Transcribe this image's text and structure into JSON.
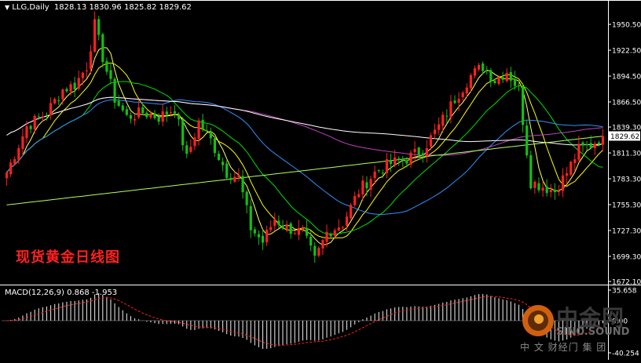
{
  "header": {
    "symbol": "LLG,Daily",
    "ohlc": "1828.13 1830.96 1825.82 1829.62"
  },
  "macd": {
    "label": "MACD(12,26,9) 0.868 -1.953",
    "ticks": [
      "35.658",
      "0.00",
      "-40.254"
    ]
  },
  "overlay_title": "现货黄金日线图",
  "watermark": {
    "cn": "中金网",
    "en": "SINO.SOUND",
    "sub": "中 文 财经门 集 团"
  },
  "price_axis": {
    "ticks": [
      "1950.50",
      "1922.50",
      "1894.50",
      "1866.50",
      "1839.30",
      "1811.30",
      "1783.30",
      "1755.30",
      "1727.30",
      "1699.30",
      "1672.10"
    ],
    "current": "1829.62"
  },
  "colors": {
    "up": "#ff2020",
    "down": "#10c010",
    "ma_fast": "#ffff60",
    "ma_mid": "#ffff00",
    "ma_green": "#00e000",
    "ma_blue": "#3090ff",
    "ma_magenta": "#c040c0",
    "ma_white": "#ffffff",
    "ma_lime": "#b0ff60",
    "macd_signal": "#ff2020"
  },
  "chart_data": {
    "type": "candlestick",
    "title": "现货黄金日线图",
    "symbol": "LLG",
    "timeframe": "Daily",
    "last_close": 1829.62,
    "ylim": [
      1672.1,
      1965
    ],
    "series_count": 150
  }
}
